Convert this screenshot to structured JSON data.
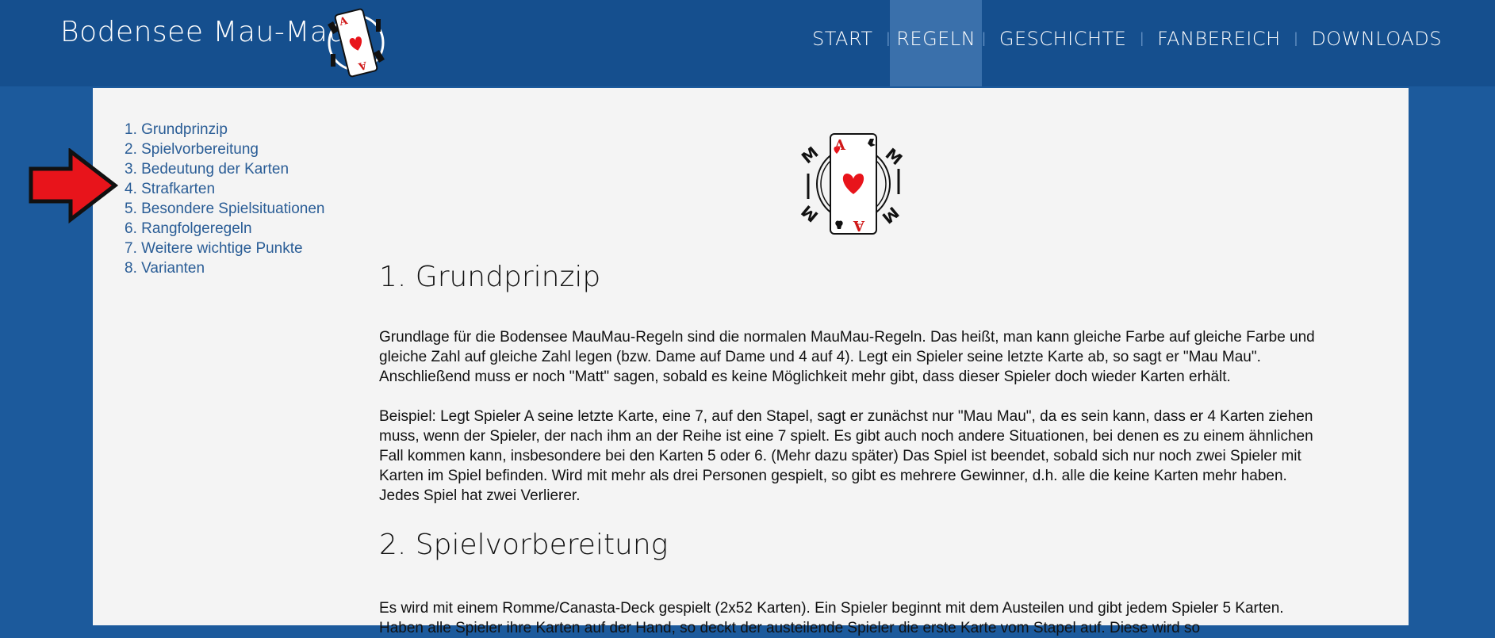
{
  "header": {
    "site_title": "Bodensee Mau-Mau",
    "logo_icon": "ace-of-hearts-card-icon",
    "nav": [
      {
        "label": "START",
        "active": false
      },
      {
        "label": "REGELN",
        "active": true
      },
      {
        "label": "GESCHICHTE",
        "active": false
      },
      {
        "label": "FANBEREICH",
        "active": false
      },
      {
        "label": "DOWNLOADS",
        "active": false
      }
    ],
    "separator": "|"
  },
  "toc": {
    "items": [
      {
        "label": "1. Grundprinzip"
      },
      {
        "label": "2. Spielvorbereitung"
      },
      {
        "label": "3. Bedeutung der Karten"
      },
      {
        "label": "4. Strafkarten"
      },
      {
        "label": "5. Besondere Spielsituationen"
      },
      {
        "label": "6. Rangfolgeregeln"
      },
      {
        "label": "7. Weitere wichtige Punkte"
      },
      {
        "label": "8. Varianten"
      }
    ]
  },
  "annotation": {
    "icon": "red-arrow-icon",
    "color": "#e8141b"
  },
  "sections": [
    {
      "title": "1. Grundprinzip",
      "paragraphs": [
        "Grundlage für die Bodensee MauMau-Regeln sind die normalen MauMau-Regeln. Das heißt, man kann gleiche Farbe auf gleiche Farbe und gleiche Zahl auf gleiche Zahl legen (bzw. Dame auf Dame und 4 auf 4). Legt ein Spieler seine letzte Karte ab, so sagt er \"Mau Mau\". Anschließend muss er noch \"Matt\" sagen, sobald es keine Möglichkeit mehr gibt, dass dieser Spieler doch wieder Karten erhält.",
        "Beispiel: Legt Spieler A seine letzte Karte, eine 7, auf den Stapel, sagt er zunächst nur \"Mau Mau\", da es sein kann, dass er 4 Karten ziehen muss, wenn der Spieler, der nach ihm an der Reihe ist eine 7 spielt. Es gibt auch noch andere Situationen, bei denen es zu einem ähnlichen Fall kommen kann, insbesondere bei den Karten 5 oder 6. (Mehr dazu später) Das Spiel ist beendet, sobald sich nur noch zwei Spieler mit Karten im Spiel befinden. Wird mit mehr als drei Personen gespielt, so gibt es mehrere Gewinner, d.h. alle die keine Karten mehr haben. Jedes Spiel hat zwei Verlierer."
      ]
    },
    {
      "title": "2. Spielvorbereitung",
      "paragraphs": [
        "Es wird mit einem Romme/Canasta-Deck gespielt (2x52 Karten). Ein Spieler beginnt mit dem Austeilen und gibt jedem Spieler 5 Karten. Haben alle Spieler ihre Karten auf der Hand, so deckt der austeilende Spieler die erste Karte vom Stapel auf. Diese wird so"
      ]
    }
  ],
  "colors": {
    "header_bg": "#154f8e",
    "page_bg": "#1c5a9c",
    "nav_active_bg": "#3a70ab",
    "content_bg": "#f4f4f4",
    "link": "#2a5d96",
    "heart": "#e8141b"
  }
}
